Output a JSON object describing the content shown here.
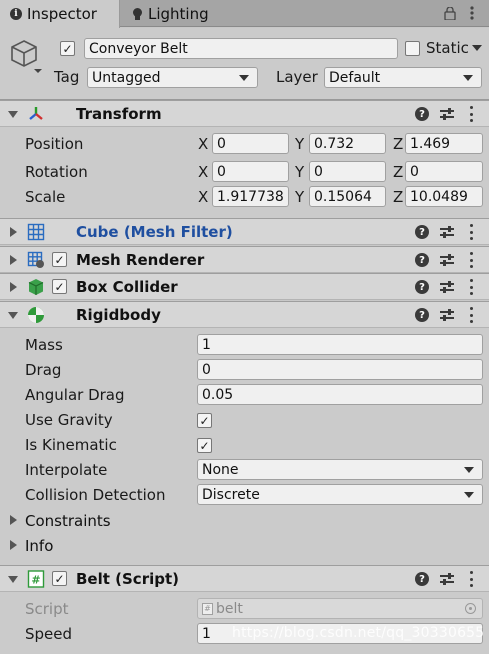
{
  "tabs": [
    {
      "label": "Inspector",
      "icon": "info-icon",
      "active": true
    },
    {
      "label": "Lighting",
      "icon": "lightbulb-icon",
      "active": false
    }
  ],
  "object": {
    "active": true,
    "name": "Conveyor Belt",
    "static_label": "Static",
    "static": false,
    "tag_label": "Tag",
    "tag_value": "Untagged",
    "layer_label": "Layer",
    "layer_value": "Default"
  },
  "transform": {
    "title": "Transform",
    "position": {
      "label": "Position",
      "x": "0",
      "y": "0.732",
      "z": "1.469"
    },
    "rotation": {
      "label": "Rotation",
      "x": "0",
      "y": "0",
      "z": "0"
    },
    "scale": {
      "label": "Scale",
      "x": "1.917738",
      "y": "0.15064",
      "z": "10.0489"
    },
    "axis": {
      "x": "X",
      "y": "Y",
      "z": "Z"
    }
  },
  "components": {
    "mesh_filter": "Cube (Mesh Filter)",
    "mesh_renderer": "Mesh Renderer",
    "box_collider": "Box Collider"
  },
  "rigidbody": {
    "title": "Rigidbody",
    "mass_label": "Mass",
    "mass": "1",
    "drag_label": "Drag",
    "drag": "0",
    "angular_drag_label": "Angular Drag",
    "angular_drag": "0.05",
    "use_gravity_label": "Use Gravity",
    "use_gravity": true,
    "is_kinematic_label": "Is Kinematic",
    "is_kinematic": true,
    "interpolate_label": "Interpolate",
    "interpolate": "None",
    "collision_label": "Collision Detection",
    "collision": "Discrete",
    "constraints_label": "Constraints",
    "info_label": "Info"
  },
  "script_component": {
    "title": "Belt (Script)",
    "script_label": "Script",
    "script_value": "belt",
    "speed_label": "Speed",
    "speed": "1"
  },
  "watermark": "https://blog.csdn.net/qq_30330655",
  "colors": {
    "link": "#1f4fa0",
    "transform_red": "#d03030",
    "transform_green": "#2a9a2a",
    "transform_blue": "#2a5fd0",
    "rigidbody_green": "#2f9a3a"
  }
}
